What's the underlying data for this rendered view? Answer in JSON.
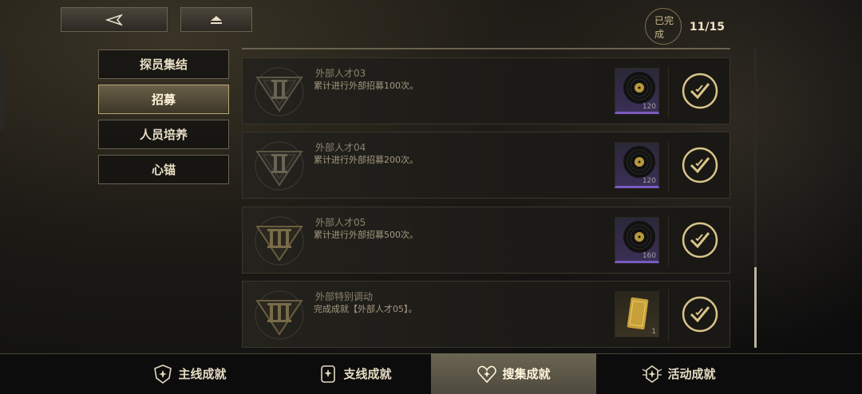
{
  "completion": {
    "label": "已完成",
    "count": "11/15"
  },
  "side_tabs": [
    {
      "label": "探员集结"
    },
    {
      "label": "招募"
    },
    {
      "label": "人员培养"
    },
    {
      "label": "心锚"
    }
  ],
  "achievements": [
    {
      "title": "外部人才03",
      "desc": "累计进行外部招募100次。",
      "emblem": "II",
      "reward_count": "120"
    },
    {
      "title": "外部人才04",
      "desc": "累计进行外部招募200次。",
      "emblem": "II",
      "reward_count": "120"
    },
    {
      "title": "外部人才05",
      "desc": "累计进行外部招募500次。",
      "emblem": "III",
      "reward_count": "160"
    },
    {
      "title": "外部特别调动",
      "desc": "完成成就【外部人才05】。",
      "emblem": "III",
      "reward_count": "1"
    }
  ],
  "bottom_tabs": [
    {
      "label": "主线成就"
    },
    {
      "label": "支线成就"
    },
    {
      "label": "搜集成就"
    },
    {
      "label": "活动成就"
    }
  ],
  "colors": {
    "accent": "#d8c48a",
    "reward_purple": "#7a5ac0",
    "active_tab": "#6a6452"
  }
}
